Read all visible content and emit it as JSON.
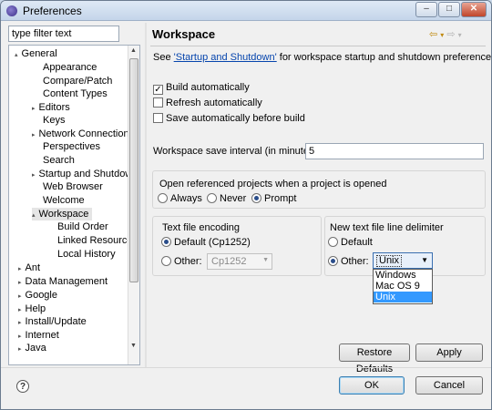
{
  "window": {
    "title": "Preferences"
  },
  "filter": {
    "value": "type filter text"
  },
  "tree": {
    "items": [
      {
        "label": "General",
        "expander": "▴"
      },
      {
        "label": "Appearance"
      },
      {
        "label": "Compare/Patch"
      },
      {
        "label": "Content Types"
      },
      {
        "label": "Editors",
        "expander": "▸"
      },
      {
        "label": "Keys"
      },
      {
        "label": "Network Connections",
        "expander": "▸"
      },
      {
        "label": "Perspectives"
      },
      {
        "label": "Search"
      },
      {
        "label": "Startup and Shutdown",
        "expander": "▸"
      },
      {
        "label": "Web Browser"
      },
      {
        "label": "Welcome"
      },
      {
        "label": "Workspace",
        "expander": "▴"
      },
      {
        "label": "Build Order"
      },
      {
        "label": "Linked Resources"
      },
      {
        "label": "Local History"
      },
      {
        "label": "Ant",
        "expander": "▸"
      },
      {
        "label": "Data Management",
        "expander": "▸"
      },
      {
        "label": "Google",
        "expander": "▸"
      },
      {
        "label": "Help",
        "expander": "▸"
      },
      {
        "label": "Install/Update",
        "expander": "▸"
      },
      {
        "label": "Internet",
        "expander": "▸"
      },
      {
        "label": "Java",
        "expander": "▸"
      }
    ]
  },
  "page": {
    "title": "Workspace",
    "see_prefix": "See ",
    "see_link": "'Startup and Shutdown'",
    "see_suffix": " for workspace startup and shutdown preferences.",
    "build_auto": "Build automatically",
    "refresh_auto": "Refresh automatically",
    "save_auto": "Save automatically before build",
    "save_interval_label": "Workspace save interval (in minutes):",
    "save_interval_value": "5",
    "open_projects_title": "Open referenced projects when a project is opened",
    "always": "Always",
    "never": "Never",
    "prompt": "Prompt",
    "encoding_title": "Text file encoding",
    "encoding_default": "Default (Cp1252)",
    "encoding_other": "Other:",
    "encoding_other_value": "Cp1252",
    "delimiter_title": "New text file line delimiter",
    "delimiter_default": "Default",
    "delimiter_other": "Other:",
    "delimiter_value": "Unix",
    "delimiter_options": [
      "Windows",
      "Mac OS 9",
      "Unix"
    ],
    "restore_defaults": "Restore Defaults",
    "apply": "Apply"
  },
  "footer": {
    "ok": "OK",
    "cancel": "Cancel"
  }
}
